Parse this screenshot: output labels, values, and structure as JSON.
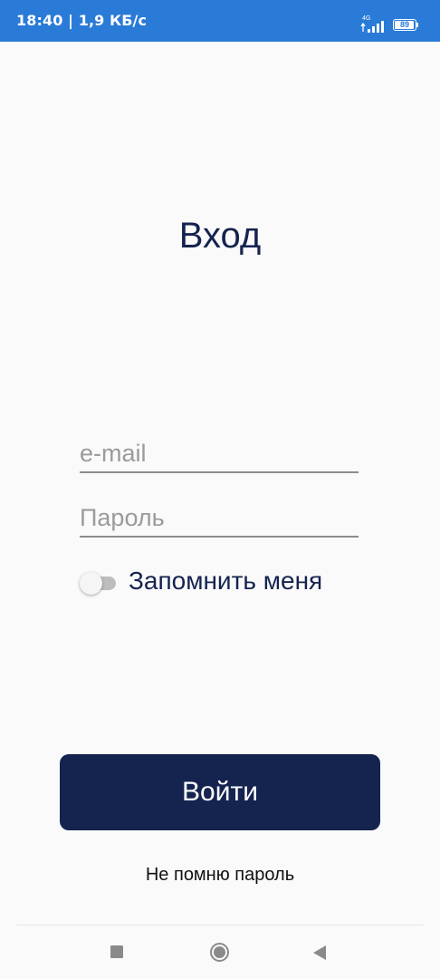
{
  "status_bar": {
    "time_speed": "18:40 | 1,9 КБ/с",
    "network": "4G",
    "battery_level": "89"
  },
  "login": {
    "title": "Вход",
    "email_placeholder": "e-mail",
    "email_value": "",
    "password_placeholder": "Пароль",
    "password_value": "",
    "remember_label": "Запомнить меня",
    "remember_on": false,
    "submit_label": "Войти",
    "forgot_label": "Не помню пароль"
  },
  "colors": {
    "status_bar": "#2a7bd7",
    "accent": "#15234f",
    "background": "#fafafa"
  },
  "icons": {
    "signal": "signal-icon",
    "battery": "battery-icon",
    "nav_recent": "recent-apps-icon",
    "nav_home": "home-icon",
    "nav_back": "back-icon"
  }
}
